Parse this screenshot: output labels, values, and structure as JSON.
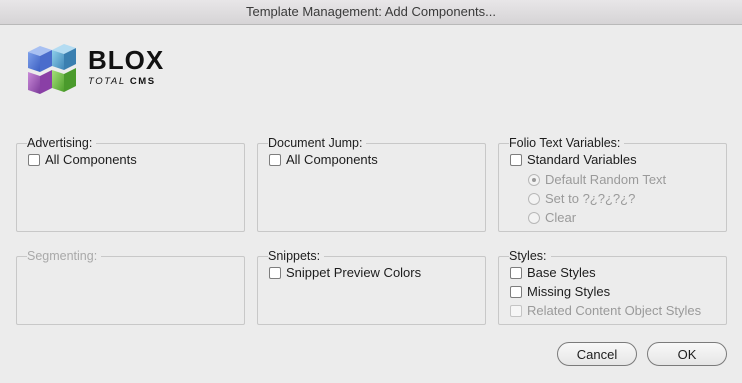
{
  "window": {
    "title": "Template Management: Add Components..."
  },
  "logo": {
    "main": "BLOX",
    "sub_italic": "TOTAL",
    "sub_bold": "CMS"
  },
  "groups": {
    "advertising": {
      "label": "Advertising:",
      "options": [
        {
          "label": "All Components",
          "checked": false
        }
      ]
    },
    "document_jump": {
      "label": "Document Jump:",
      "options": [
        {
          "label": "All Components",
          "checked": false
        }
      ]
    },
    "folio": {
      "label": "Folio Text Variables:",
      "options": [
        {
          "label": "Standard Variables",
          "checked": false
        }
      ],
      "radios": [
        {
          "label": "Default Random Text",
          "selected": true,
          "enabled": false
        },
        {
          "label": "Set to ?¿?¿?¿?",
          "selected": false,
          "enabled": false
        },
        {
          "label": "Clear",
          "selected": false,
          "enabled": false
        }
      ]
    },
    "segmenting": {
      "label": "Segmenting:",
      "enabled": false
    },
    "snippets": {
      "label": "Snippets:",
      "options": [
        {
          "label": "Snippet Preview Colors",
          "checked": false
        }
      ]
    },
    "styles": {
      "label": "Styles:",
      "options": [
        {
          "label": "Base Styles",
          "checked": false,
          "enabled": true
        },
        {
          "label": "Missing Styles",
          "checked": false,
          "enabled": true
        },
        {
          "label": "Related Content Object Styles",
          "checked": false,
          "enabled": false
        }
      ]
    }
  },
  "buttons": {
    "cancel": "Cancel",
    "ok": "OK"
  }
}
